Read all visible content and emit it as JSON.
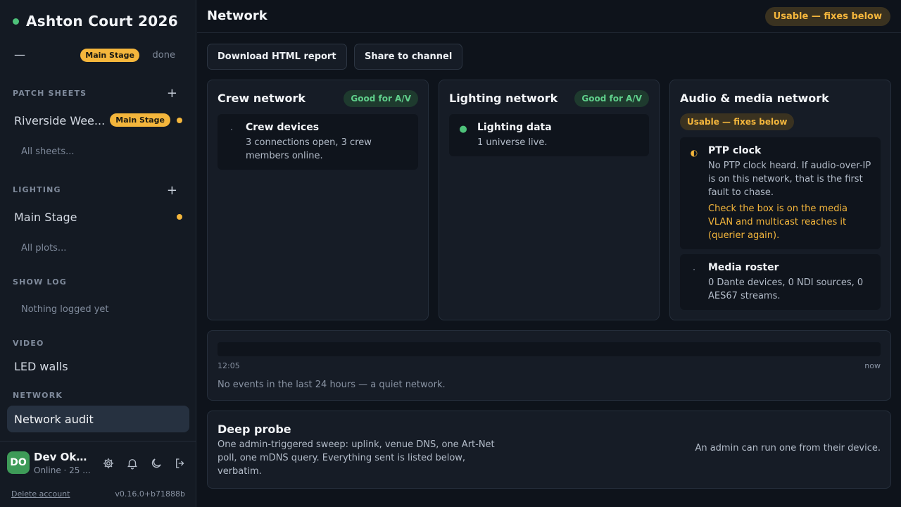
{
  "app": {
    "title": "Ashton Court 2026",
    "status_color": "#4ec27a"
  },
  "stage_row": {
    "dash": "—",
    "badge": "Main Stage",
    "done": "done"
  },
  "sidebar": {
    "patch_sheets": {
      "heading": "PATCH SHEETS",
      "add": "+",
      "item": {
        "label": "Riverside Wee...",
        "badge": "Main Stage"
      },
      "sub": "All sheets..."
    },
    "lighting": {
      "heading": "LIGHTING",
      "add": "+",
      "item": {
        "label": "Main Stage"
      },
      "sub": "All plots..."
    },
    "show_log": {
      "heading": "SHOW LOG",
      "empty": "Nothing logged yet"
    },
    "video": {
      "heading": "VIDEO",
      "item": "LED walls"
    },
    "network": {
      "heading": "NETWORK",
      "item": "Network audit"
    }
  },
  "user": {
    "initials": "DO",
    "name": "Dev Oka...",
    "status": "Online · 25 ...",
    "delete": "Delete account",
    "version": "v0.16.0+b71888b",
    "icons": [
      "gear-icon",
      "bell-icon",
      "moon-icon",
      "logout-icon"
    ]
  },
  "header": {
    "title": "Network",
    "status": "Usable — fixes below"
  },
  "actions": {
    "download": "Download HTML report",
    "share": "Share to channel"
  },
  "panels": {
    "crew": {
      "title": "Crew network",
      "badge": "Good for A/V",
      "card": {
        "icon": "·",
        "title": "Crew devices",
        "body": "3 connections open, 3 crew members online."
      }
    },
    "lighting": {
      "title": "Lighting network",
      "badge": "Good for A/V",
      "card": {
        "icon": "●",
        "title": "Lighting data",
        "body": "1 universe live."
      }
    },
    "audio": {
      "title": "Audio & media network",
      "badge": "Usable — fixes below",
      "ptp": {
        "icon": "◐",
        "title": "PTP clock",
        "body": "No PTP clock heard. If audio-over-IP is on this network, that is the first fault to chase.",
        "hint": "Check the box is on the media VLAN and multicast reaches it (querier again)."
      },
      "roster": {
        "icon": "·",
        "title": "Media roster",
        "body": "0 Dante devices, 0 NDI sources, 0 AES67 streams."
      }
    }
  },
  "timeline": {
    "start": "12:05",
    "end": "now",
    "message": "No events in the last 24 hours — a quiet network."
  },
  "probe": {
    "title": "Deep probe",
    "description": "One admin-triggered sweep: uplink, venue DNS, one Art-Net poll, one mDNS query. Everything sent is listed below, verbatim.",
    "note": "An admin can run one from their device."
  },
  "colors": {
    "accent": "#f4b63c",
    "good": "#5fcf8b",
    "good_dot": "#4ec27a"
  }
}
